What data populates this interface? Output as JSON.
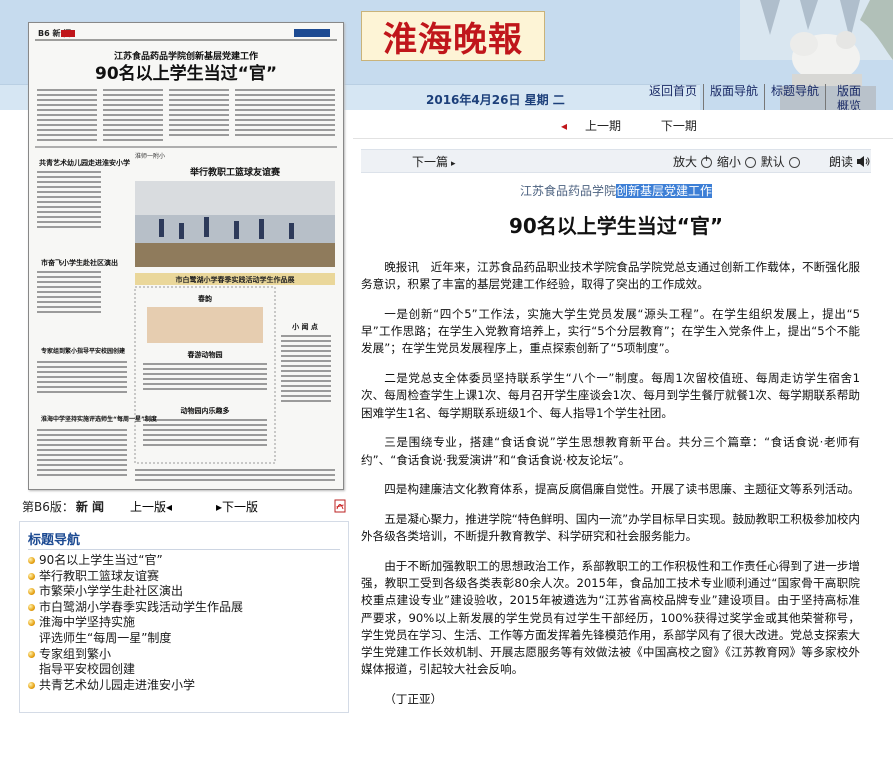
{
  "header": {
    "logo_text": "淮海晚報",
    "date": "2016年4月26日 星期 二",
    "nav": [
      "返回首页",
      "版面导航",
      "标题导航",
      "版面概览"
    ],
    "brand_color": "#c0161b"
  },
  "page_image": {
    "page_header": "B6 新 闻",
    "subtitle": "江苏食品药品学院创新基层党建工作",
    "title": "90名以上学生当过“官”",
    "section_a": "共青艺术幼儿园走进淮安小学",
    "section_b": "举行教职工篮球友谊赛",
    "photo_caption": "淮师一附小",
    "section_c": "市奋飞小学生赴社区演出",
    "poster_banner": "市白鹭湖小学春季实践活动学生作品展",
    "sub_1": "春韵",
    "sub_2": "春游动物园",
    "sub_3": "动物园内乐趣多",
    "side_1": "专家组到繁小指导平安校园创建",
    "side_2": "淮海中学坚持实施评选师生“每周一星”制度",
    "col_head": "小 闻 点"
  },
  "left_pager": {
    "page_label": "第B6版：",
    "page_name": "新 闻",
    "prev": "上一版",
    "next": "下一版"
  },
  "title_nav": {
    "heading": "标题导航",
    "items": [
      [
        "90名以上学生当过“官”"
      ],
      [
        "举行教职工篮球友谊赛"
      ],
      [
        "市繁荣小学学生赴社区演出"
      ],
      [
        "市白鹭湖小学春季实践活动学生作品展"
      ],
      [
        "淮海中学坚持实施",
        "评选师生“每周一星”制度"
      ],
      [
        "专家组到繁小",
        "指导平安校园创建"
      ],
      [
        "共青艺术幼儿园走进淮安小学"
      ]
    ]
  },
  "controls": {
    "prev": "上一期",
    "next": "下一期",
    "article_next": "下一篇",
    "zoom_in": "放大",
    "zoom_out": "缩小",
    "default": "默认",
    "read": "朗读"
  },
  "article": {
    "kicker_plain": "江苏食品药品学院",
    "kicker_highlight": "创新基层党建工作",
    "headline": "90名以上学生当过“官”",
    "paragraphs": [
      "晚报讯　近年来，江苏食品药品职业技术学院食品学院党总支通过创新工作载体，不断强化服务意识，积累了丰富的基层党建工作经验，取得了突出的工作成效。",
      "一是创新“四个5”工作法，实施大学生党员发展“源头工程”。在学生组织发展上，提出“5早”工作思路；在学生入党教育培养上，实行“5个分层教育”；在学生入党条件上，提出“5个不能发展”；在学生党员发展程序上，重点探索创新了“5项制度”。",
      "二是党总支全体委员坚持联系学生“八个一”制度。每周1次留校值班、每周走访学生宿舍1次、每周检查学生上课1次、每月召开学生座谈会1次、每月到学生餐厅就餐1次、每学期联系帮助困难学生1名、每学期联系班级1个、每人指导1个学生社团。",
      "三是围绕专业，搭建“食话食说”学生思想教育新平台。共分三个篇章：“食话食说·老师有约”、“食话食说·我爱演讲”和“食话食说·校友论坛”。",
      "四是构建廉洁文化教育体系，提高反腐倡廉自觉性。开展了读书思廉、主题征文等系列活动。",
      "五是凝心聚力，推进学院“特色鲜明、国内一流”办学目标早日实现。鼓励教职工积极参加校内外各级各类培训，不断提升教育教学、科学研究和社会服务能力。",
      "由于不断加强教职工的思想政治工作，系部教职工的工作积极性和工作责任心得到了进一步增强，教职工受到各级各类表彰80余人次。2015年，食品加工技术专业顺利通过“国家骨干高职院校重点建设专业”建设验收，2015年被遴选为“江苏省高校品牌专业”建设项目。由于坚持高标准严要求，90%以上新发展的学生党员有过学生干部经历，100%获得过奖学金或其他荣誉称号，学生党员在学习、生活、工作等方面发挥着先锋模范作用，系部学风有了很大改进。党总支探索大学生党建工作长效机制、开展志愿服务等有效做法被《中国高校之窗》《江苏教育网》等多家校外媒体报道，引起较大社会反响。",
      "（丁正亚）"
    ]
  }
}
